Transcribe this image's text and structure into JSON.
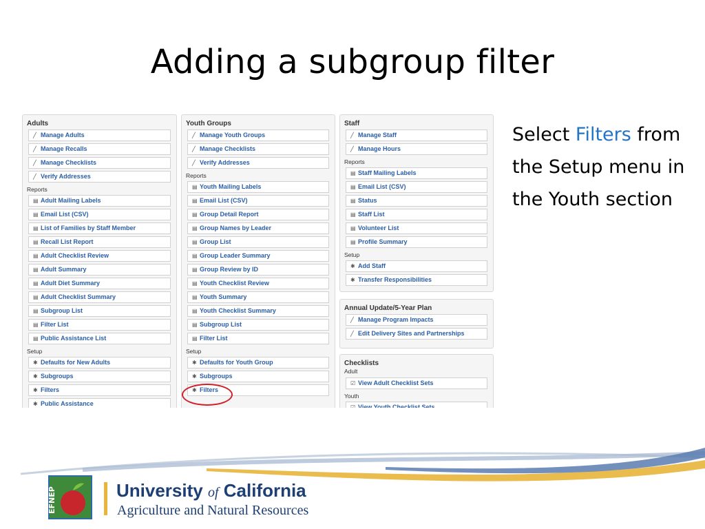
{
  "slide": {
    "title": "Adding a subgroup filter",
    "side_text": {
      "before": "Select ",
      "highlight": "Filters",
      "after": " from the Setup menu in the Youth section"
    }
  },
  "panels": {
    "adults": {
      "title": "Adults",
      "sections": [
        {
          "label": "",
          "icon": "pencil-icon",
          "items": [
            "Manage Adults",
            "Manage Recalls",
            "Manage Checklists",
            "Verify Addresses"
          ]
        },
        {
          "label": "Reports",
          "icon": "report-icon",
          "items": [
            "Adult Mailing Labels",
            "Email List (CSV)",
            "List of Families by Staff Member",
            "Recall List Report",
            "Adult Checklist Review",
            "Adult Summary",
            "Adult Diet Summary",
            "Adult Checklist Summary",
            "Subgroup List",
            "Filter List",
            "Public Assistance List"
          ]
        },
        {
          "label": "Setup",
          "icon": "gear-icon",
          "items": [
            "Defaults for New Adults",
            "Subgroups",
            "Filters",
            "Public Assistance"
          ]
        }
      ]
    },
    "youth": {
      "title": "Youth Groups",
      "sections": [
        {
          "label": "",
          "icon": "pencil-icon",
          "items": [
            "Manage Youth Groups",
            "Manage Checklists",
            "Verify Addresses"
          ]
        },
        {
          "label": "Reports",
          "icon": "report-icon",
          "items": [
            "Youth Mailing Labels",
            "Email List (CSV)",
            "Group Detail Report",
            "Group Names by Leader",
            "Group List",
            "Group Leader Summary",
            "Group Review by ID",
            "Youth Checklist Review",
            "Youth Summary",
            "Youth Checklist Summary",
            "Subgroup List",
            "Filter List"
          ]
        },
        {
          "label": "Setup",
          "icon": "gear-icon",
          "items": [
            "Defaults for Youth Group",
            "Subgroups",
            "Filters"
          ]
        }
      ]
    },
    "staff": {
      "title": "Staff",
      "sections": [
        {
          "label": "",
          "icon": "pencil-icon",
          "items": [
            "Manage Staff",
            "Manage Hours"
          ]
        },
        {
          "label": "Reports",
          "icon": "report-icon",
          "items": [
            "Staff Mailing Labels",
            "Email List (CSV)",
            "Status",
            "Staff List",
            "Volunteer List",
            "Profile Summary"
          ]
        },
        {
          "label": "Setup",
          "icon": "gear-icon",
          "items": [
            "Add Staff",
            "Transfer Responsibilities"
          ]
        }
      ]
    },
    "annual": {
      "title": "Annual Update/5-Year Plan",
      "sections": [
        {
          "label": "",
          "icon": "pencil-icon",
          "items": [
            "Manage Program Impacts",
            "Edit Delivery Sites and Partnerships"
          ]
        }
      ]
    },
    "checklists": {
      "title": "Checklists",
      "sections": [
        {
          "label": "Adult",
          "icon": "checkbox-icon",
          "items": [
            "View Adult Checklist Sets"
          ]
        },
        {
          "label": "Youth",
          "icon": "checkbox-icon",
          "items": [
            "View Youth Checklist Sets"
          ]
        }
      ]
    }
  },
  "footer": {
    "org_line1_a": "University ",
    "org_line1_of": "of",
    "org_line1_b": " California",
    "org_line2": "Agriculture and Natural Resources",
    "logo_text": "EFNEP"
  },
  "colors": {
    "link": "#2a5ea8",
    "highlight": "#2374c6",
    "circle": "#d11f2a",
    "brand_navy": "#1d3f73",
    "brand_gold": "#e8b43a"
  }
}
